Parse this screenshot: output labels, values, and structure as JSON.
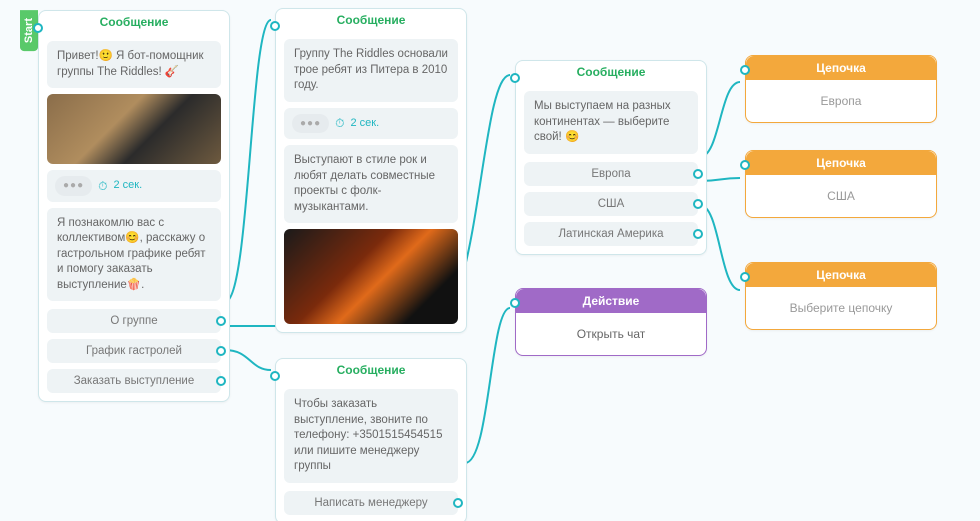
{
  "start_label": "Start",
  "nodes": {
    "n1": {
      "type": "message",
      "header": "Сообщение",
      "blocks": [
        {
          "kind": "text",
          "text": "Привет!🙂 Я бот-помощник группы The Riddles! 🎸"
        },
        {
          "kind": "image"
        },
        {
          "kind": "delay",
          "dots": "●●●",
          "label": "2 сек."
        },
        {
          "kind": "text",
          "text": "Я познакомлю вас с коллективом😊, расскажу о гастрольном графике ребят и помогу заказать выступление🍿."
        }
      ],
      "options": [
        {
          "label": "О группе"
        },
        {
          "label": "График гастролей"
        },
        {
          "label": "Заказать выступление"
        }
      ]
    },
    "n2": {
      "type": "message",
      "header": "Сообщение",
      "blocks": [
        {
          "kind": "text",
          "text": "Группу The Riddles основали трое ребят из Питера в 2010 году."
        },
        {
          "kind": "delay",
          "dots": "●●●",
          "label": "2 сек."
        },
        {
          "kind": "text",
          "text": "Выступают в стиле рок и любят делать совместные проекты с фолк-музыкантами."
        },
        {
          "kind": "image"
        }
      ],
      "options": []
    },
    "n3": {
      "type": "message",
      "header": "Сообщение",
      "blocks": [
        {
          "kind": "text",
          "text": "Мы выступаем на разных континентах — выберите свой! 😊"
        }
      ],
      "options": [
        {
          "label": "Европа"
        },
        {
          "label": "США"
        },
        {
          "label": "Латинская Америка"
        }
      ]
    },
    "n4": {
      "type": "message",
      "header": "Сообщение",
      "blocks": [
        {
          "kind": "text",
          "text": "Чтобы заказать выступление, звоните по телефону: +3501515454515\nили пишите менеджеру группы"
        }
      ],
      "options": [
        {
          "label": "Написать менеджеру"
        }
      ]
    },
    "n5": {
      "type": "action",
      "header": "Действие",
      "body": "Открыть чат"
    },
    "c1": {
      "type": "chain",
      "header": "Цепочка",
      "body": "Европа"
    },
    "c2": {
      "type": "chain",
      "header": "Цепочка",
      "body": "США"
    },
    "c3": {
      "type": "chain",
      "header": "Цепочка",
      "body": "Выберите цепочку"
    }
  },
  "chart_data": null
}
